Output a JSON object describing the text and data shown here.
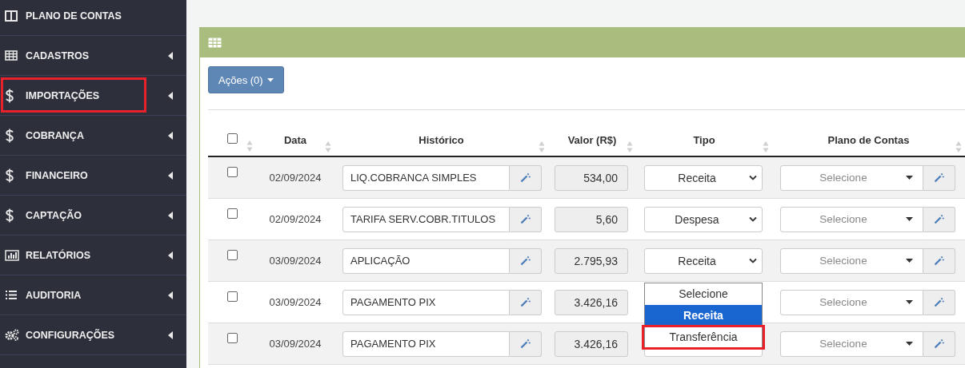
{
  "sidebar": {
    "items": [
      {
        "label": "PLANO DE CONTAS",
        "expandable": false,
        "highlighted": false
      },
      {
        "label": "CADASTROS",
        "expandable": true,
        "highlighted": false
      },
      {
        "label": "IMPORTAÇÕES",
        "expandable": true,
        "highlighted": true
      },
      {
        "label": "COBRANÇA",
        "expandable": true,
        "highlighted": false
      },
      {
        "label": "FINANCEIRO",
        "expandable": true,
        "highlighted": false
      },
      {
        "label": "CAPTAÇÃO",
        "expandable": true,
        "highlighted": false
      },
      {
        "label": "RELATÓRIOS",
        "expandable": true,
        "highlighted": false
      },
      {
        "label": "AUDITORIA",
        "expandable": true,
        "highlighted": false
      },
      {
        "label": "CONFIGURAÇÕES",
        "expandable": true,
        "highlighted": false
      }
    ]
  },
  "panel": {
    "actions_button": "Ações (0)",
    "table": {
      "columns": [
        {
          "kind": "checkbox",
          "checked": false
        },
        {
          "kind": "text",
          "label": "Data"
        },
        {
          "kind": "text",
          "label": "Histórico"
        },
        {
          "kind": "text",
          "label": "Valor (R$)"
        },
        {
          "kind": "text",
          "label": "Tipo"
        },
        {
          "kind": "text",
          "label": "Plano de Contas"
        }
      ],
      "rows": [
        {
          "checked": false,
          "date": "02/09/2024",
          "historico": "LIQ.COBRANCA SIMPLES",
          "valor": "534,00",
          "tipo": "Receita",
          "plano": "Selecione"
        },
        {
          "checked": false,
          "date": "02/09/2024",
          "historico": "TARIFA SERV.COBR.TITULOS",
          "valor": "5,60",
          "tipo": "Despesa",
          "plano": "Selecione"
        },
        {
          "checked": false,
          "date": "03/09/2024",
          "historico": "APLICAÇÃO",
          "valor": "2.795,93",
          "tipo": "Receita",
          "plano": "Selecione",
          "dropdown": [
            {
              "label": "Selecione",
              "selected": false,
              "highlighted": false
            },
            {
              "label": "Receita",
              "selected": true,
              "highlighted": false
            },
            {
              "label": "Transferência",
              "selected": false,
              "highlighted": true
            }
          ]
        },
        {
          "checked": false,
          "date": "03/09/2024",
          "historico": "PAGAMENTO PIX",
          "valor": "3.426,16",
          "plano": "Selecione"
        },
        {
          "checked": false,
          "date": "03/09/2024",
          "historico": "PAGAMENTO PIX",
          "valor": "3.426,16",
          "plano": "Selecione"
        }
      ]
    }
  }
}
